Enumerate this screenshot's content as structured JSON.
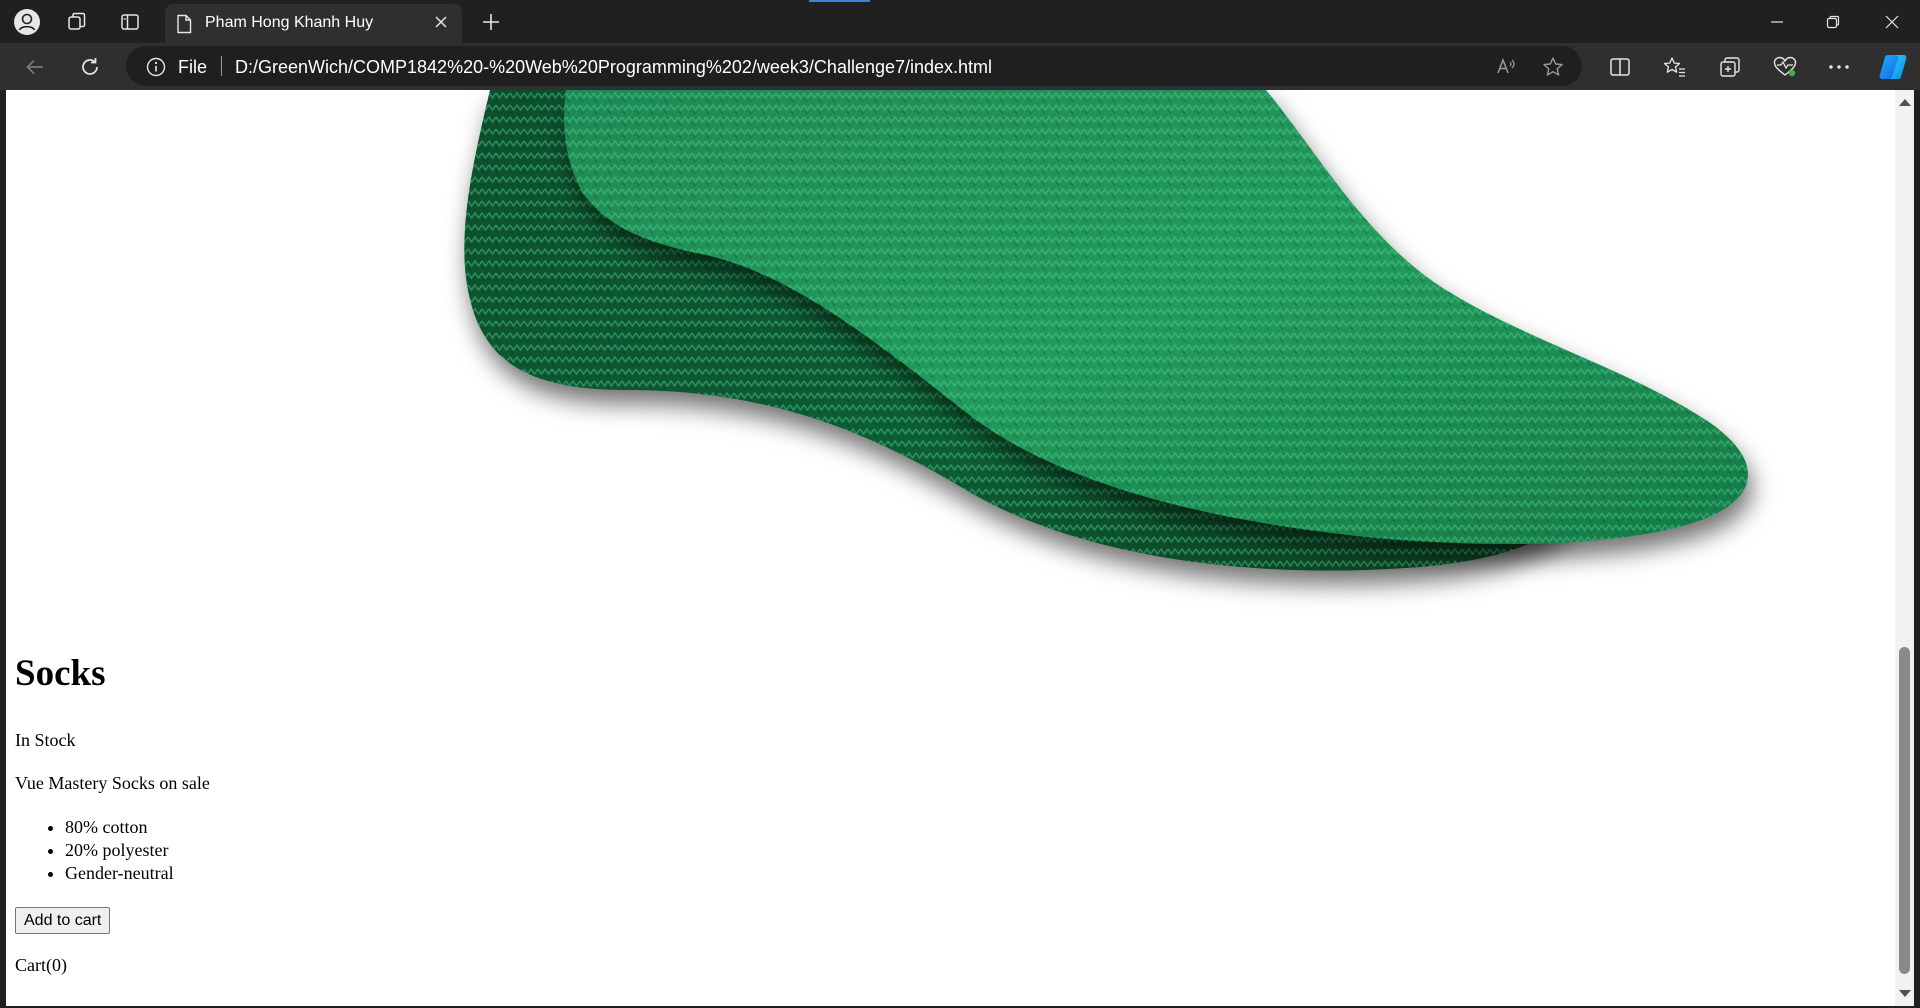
{
  "browser": {
    "tab_title": "Pham Hong Khanh Huy",
    "address": {
      "scheme_label": "File",
      "url": "D:/GreenWich/COMP1842%20-%20Web%20Programming%202/week3/Challenge7/index.html"
    },
    "icons": {
      "profile": "profile-icon",
      "workspaces": "workspaces-icon",
      "vertical_tabs": "vertical-tabs-icon",
      "new_tab": "plus-icon",
      "back": "back-arrow-icon",
      "refresh": "refresh-icon",
      "read_aloud": "read-aloud-icon",
      "favorite": "star-icon",
      "split_screen": "split-screen-icon",
      "favorites": "favorites-icon",
      "collections": "collections-icon",
      "performance": "heartbeat-icon",
      "more": "more-icon",
      "copilot": "copilot-icon"
    },
    "colors": {
      "chrome_dark": "#202020",
      "toolbar": "#2f2f2f",
      "accent": "#3b86d6"
    }
  },
  "product": {
    "image_alt": "green knitted sock",
    "title": "Socks",
    "stock_status": "In Stock",
    "description": "Vue Mastery Socks on sale",
    "details": [
      "80% cotton",
      "20% polyester",
      "Gender-neutral"
    ],
    "add_to_cart_label": "Add to cart",
    "cart_label": "Cart(0)"
  }
}
